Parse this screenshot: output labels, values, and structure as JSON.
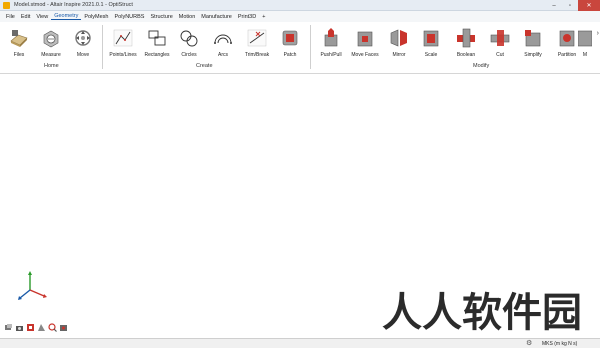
{
  "window": {
    "title": "Model.stmod - Altair Inspire 2021.0.1 - OptiStruct"
  },
  "menu": [
    {
      "label": "File"
    },
    {
      "label": "Edit"
    },
    {
      "label": "View"
    },
    {
      "label": "Geometry",
      "active": true
    },
    {
      "label": "PolyMesh"
    },
    {
      "label": "PolyNURBS"
    },
    {
      "label": "Structure"
    },
    {
      "label": "Motion"
    },
    {
      "label": "Manufacture"
    },
    {
      "label": "Print3D"
    },
    {
      "label": "+"
    }
  ],
  "ribbon": {
    "groups": {
      "home": "Home",
      "create": "Create",
      "modify": "Modify"
    },
    "tools": [
      {
        "label": "Files",
        "icon": "files-icon"
      },
      {
        "label": "Measure",
        "icon": "measure-icon"
      },
      {
        "label": "Move",
        "icon": "move-icon"
      },
      {
        "label": "Points/Lines",
        "icon": "points-lines-icon"
      },
      {
        "label": "Rectangles",
        "icon": "rectangles-icon"
      },
      {
        "label": "Circles",
        "icon": "circles-icon"
      },
      {
        "label": "Arcs",
        "icon": "arcs-icon"
      },
      {
        "label": "Trim/Break",
        "icon": "trim-break-icon"
      },
      {
        "label": "Patch",
        "icon": "patch-icon"
      },
      {
        "label": "Push/Pull",
        "icon": "push-pull-icon"
      },
      {
        "label": "Move Faces",
        "icon": "move-faces-icon"
      },
      {
        "label": "Mirror",
        "icon": "mirror-icon"
      },
      {
        "label": "Scale",
        "icon": "scale-icon"
      },
      {
        "label": "Boolean",
        "icon": "boolean-icon"
      },
      {
        "label": "Cut",
        "icon": "cut-icon"
      },
      {
        "label": "Simplify",
        "icon": "simplify-icon"
      },
      {
        "label": "Partition",
        "icon": "partition-icon"
      },
      {
        "label": "M",
        "icon": "more-icon"
      }
    ]
  },
  "status": {
    "units": "MKS (m kg N s)"
  },
  "watermark": "人人软件园",
  "colors": {
    "accent": "#1a5aa8",
    "tool_red": "#c9342c",
    "tool_grey": "#8a8a8a"
  }
}
